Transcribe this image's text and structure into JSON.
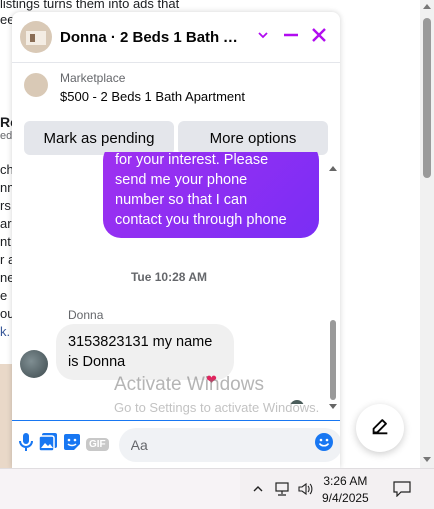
{
  "background": {
    "snippet_top": "listings turns them into ads that",
    "snippet_top2": "ee",
    "snippet_label": "Ro",
    "snippet_label2": "ed",
    "left_frag": [
      "ch",
      "nm",
      "rs,",
      "ar",
      "nt",
      "r a",
      "ne",
      "e",
      "ou",
      "k."
    ],
    "compose_icon": "edit-icon"
  },
  "chat": {
    "title": "Donna · 2 Beds 1 Bath Apa...",
    "listing_label": "Marketplace",
    "listing_desc": "$500 - 2 Beds 1 Bath Apartment",
    "mark_pending": "Mark as pending",
    "more_options": "More options",
    "accent": "#b10cf0",
    "messages": {
      "outgoing": [
        "for your interest. Please",
        "send me your phone",
        "number so that I can",
        "contact you through phone"
      ],
      "timestamp": "Tue 10:28 AM",
      "sender": "Donna",
      "incoming": "3153823131 my name is Donna",
      "reaction": "❤"
    },
    "composer": {
      "placeholder": "Aa",
      "icons": [
        "microphone-icon",
        "photo-icon",
        "sticker-icon",
        "gif-icon",
        "emoji-icon",
        "like-icon"
      ],
      "gif_label": "GIF"
    }
  },
  "watermark": {
    "title": "Activate Windows",
    "subtitle": "Go to Settings to activate Windows."
  },
  "taskbar": {
    "time": "3:26 AM",
    "date": "9/4/2025"
  }
}
